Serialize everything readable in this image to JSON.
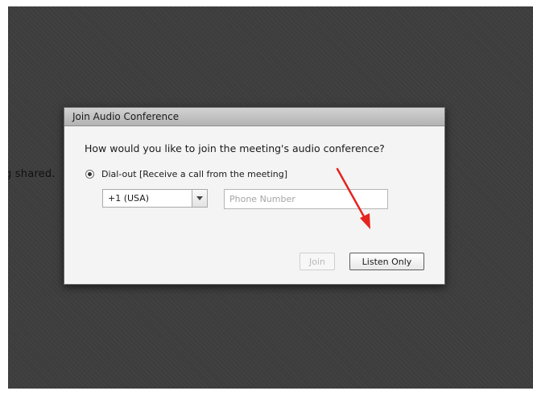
{
  "background": {
    "shared_text": "g shared."
  },
  "dialog": {
    "title": "Join Audio Conference",
    "question": "How would you like to join the meeting's audio conference?",
    "option": {
      "label": "Dial-out [Receive a call from the meeting]",
      "selected": true
    },
    "country_select": {
      "value": "+1 (USA)"
    },
    "phone_input": {
      "value": "",
      "placeholder": "Phone Number"
    },
    "buttons": {
      "join_label": "Join",
      "join_enabled": false,
      "listen_only_label": "Listen Only"
    }
  },
  "annotation": {
    "arrow_color": "#e5241f",
    "points_to": "listen-only-button"
  },
  "colors": {
    "backdrop": "#3d3d3d",
    "dialog_body": "#f4f4f4",
    "dialog_header": "#c4c4c4"
  }
}
